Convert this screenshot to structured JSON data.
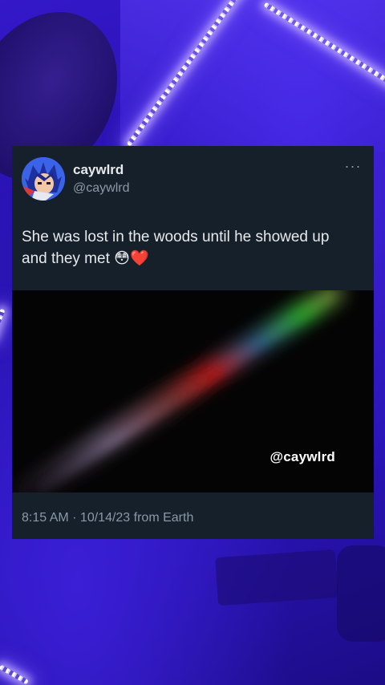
{
  "tweet": {
    "display_name": "caywlrd",
    "handle": "@caywlrd",
    "text_line1": "She was lost in the woods until he showed up",
    "text_line2": "and they met",
    "emoji_1": "😳",
    "emoji_2": "❤️",
    "media_watermark": "@caywlrd",
    "meta": "8:15 AM · 10/14/23 from Earth",
    "more_label": "···"
  },
  "colors": {
    "card_background": "#15202b",
    "primary_text": "#e7e9ea",
    "secondary_text": "#8b98a5",
    "background_purple": "#2a17b8"
  },
  "icons": {
    "more": "more-options-icon",
    "avatar": "anime-character-avatar"
  }
}
